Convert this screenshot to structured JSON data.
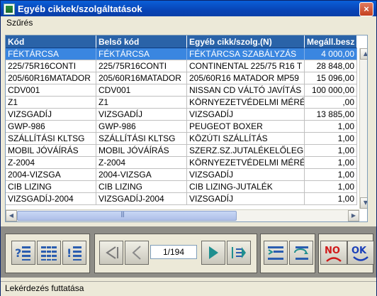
{
  "window": {
    "title": "Egyéb cikkek/szolgáltatások",
    "close_glyph": "×"
  },
  "menu": {
    "items": [
      {
        "label": "Szűrés"
      }
    ]
  },
  "table": {
    "columns": [
      "Kód",
      "Belső kód",
      "Egyéb cikk/szolg.(N)",
      "Megáll.besz"
    ],
    "rows": [
      [
        "FÉKTÁRCSA",
        "FÉKTÁRCSA",
        "FÉKTÁRCSA SZABÁLYZÁS",
        "4 000,00"
      ],
      [
        "225/75R16CONTI",
        "225/75R16CONTI",
        "CONTINENTAL 225/75 R16 T",
        "28 848,00"
      ],
      [
        "205/60R16MATADOR",
        "205/60R16MATADOR",
        "205/60R16 MATADOR MP59",
        "15 096,00"
      ],
      [
        "CDV001",
        "CDV001",
        "NISSAN CD VÁLTÓ JAVÍTÁS",
        "100 000,00"
      ],
      [
        "Z1",
        "Z1",
        "KÖRNYEZETVÉDELMI MÉRÉ",
        ",00"
      ],
      [
        "VIZSGADÍJ",
        "VIZSGADÍJ",
        "VIZSGADÍJ",
        "13 885,00"
      ],
      [
        "GWP-986",
        "GWP-986",
        "PEUGEOT BOXER",
        "1,00"
      ],
      [
        "SZÁLLÍTÁSI KLTSG",
        "SZÁLLÍTÁSI KLTSG",
        "KÖZÚTI SZÁLLÍTÁS",
        "1,00"
      ],
      [
        "MOBIL JÓVÁÍRÁS",
        "MOBIL JÓVÁÍRÁS",
        "SZERZ.SZ.JUTALÉKELŐLEG",
        "1,00"
      ],
      [
        "Z-2004",
        "Z-2004",
        "KÖRNYEZETVÉDELMI MÉRÉ",
        "1,00"
      ],
      [
        "2004-VIZSGA",
        "2004-VIZSGA",
        "VIZSGADÍJ",
        "1,00"
      ],
      [
        "CIB LIZING",
        "CIB LIZING",
        "CIB LIZING-JUTALÉK",
        "1,00"
      ],
      [
        "VIZSGADÍJ-2004",
        "VIZSGADÍJ-2004",
        "VIZSGADÍJ",
        "1,00"
      ]
    ],
    "selected_row": 0
  },
  "pager": {
    "text": "1/194"
  },
  "status": {
    "text": "Lekérdezés futtatása"
  },
  "buttons": {
    "no_label": "NO",
    "ok_label": "OK"
  }
}
